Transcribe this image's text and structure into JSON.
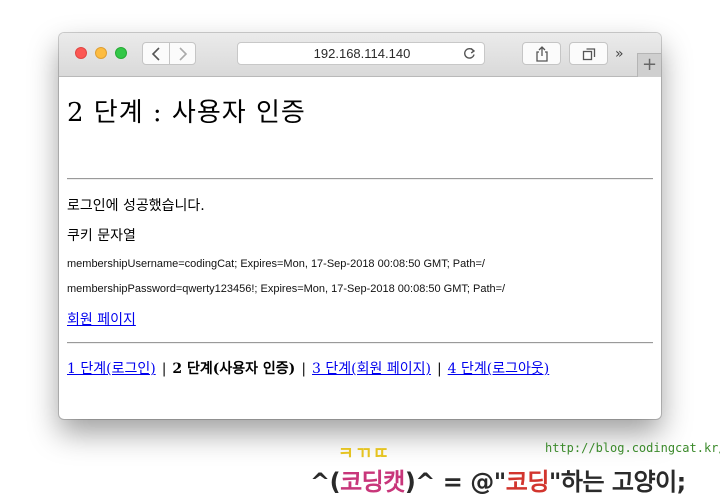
{
  "browser": {
    "address": "192.168.114.140",
    "more_label": "»",
    "newtab_label": "+"
  },
  "page": {
    "title": "2 단계 : 사용자 인증",
    "success_message": "로그인에 성공했습니다.",
    "cookie_label": "쿠키 문자열",
    "cookies": [
      "membershipUsername=codingCat; Expires=Mon, 17-Sep-2018 00:08:50 GMT; Path=/",
      "membershipPassword=qwerty123456!; Expires=Mon, 17-Sep-2018 00:08:50 GMT; Path=/"
    ],
    "member_link": "회원 페이지",
    "steps": [
      {
        "label": "1 단계(로그인)",
        "link": true
      },
      {
        "label": "2 단계(사용자 인증)",
        "link": false
      },
      {
        "label": "3 단계(회원 페이지)",
        "link": true
      },
      {
        "label": "4 단계(로그아웃)",
        "link": true
      }
    ],
    "separator": "|"
  },
  "watermark": {
    "url": "http://blog.codingcat.kr/",
    "top": "ㅋㄲㄸ",
    "prefix": "^(",
    "name": "코딩캣",
    "middle": ")^ = @\"",
    "coding": "코딩",
    "suffix": "\"하는 고양이;"
  },
  "colors": {
    "link": "#0000ee",
    "close": "#fc5753",
    "minimize": "#fdbc40",
    "zoom": "#33c748",
    "watermark_url": "#3b8a2b",
    "watermark_top": "#e5c320",
    "watermark_pink": "#c8367a",
    "watermark_red": "#d2352e"
  }
}
